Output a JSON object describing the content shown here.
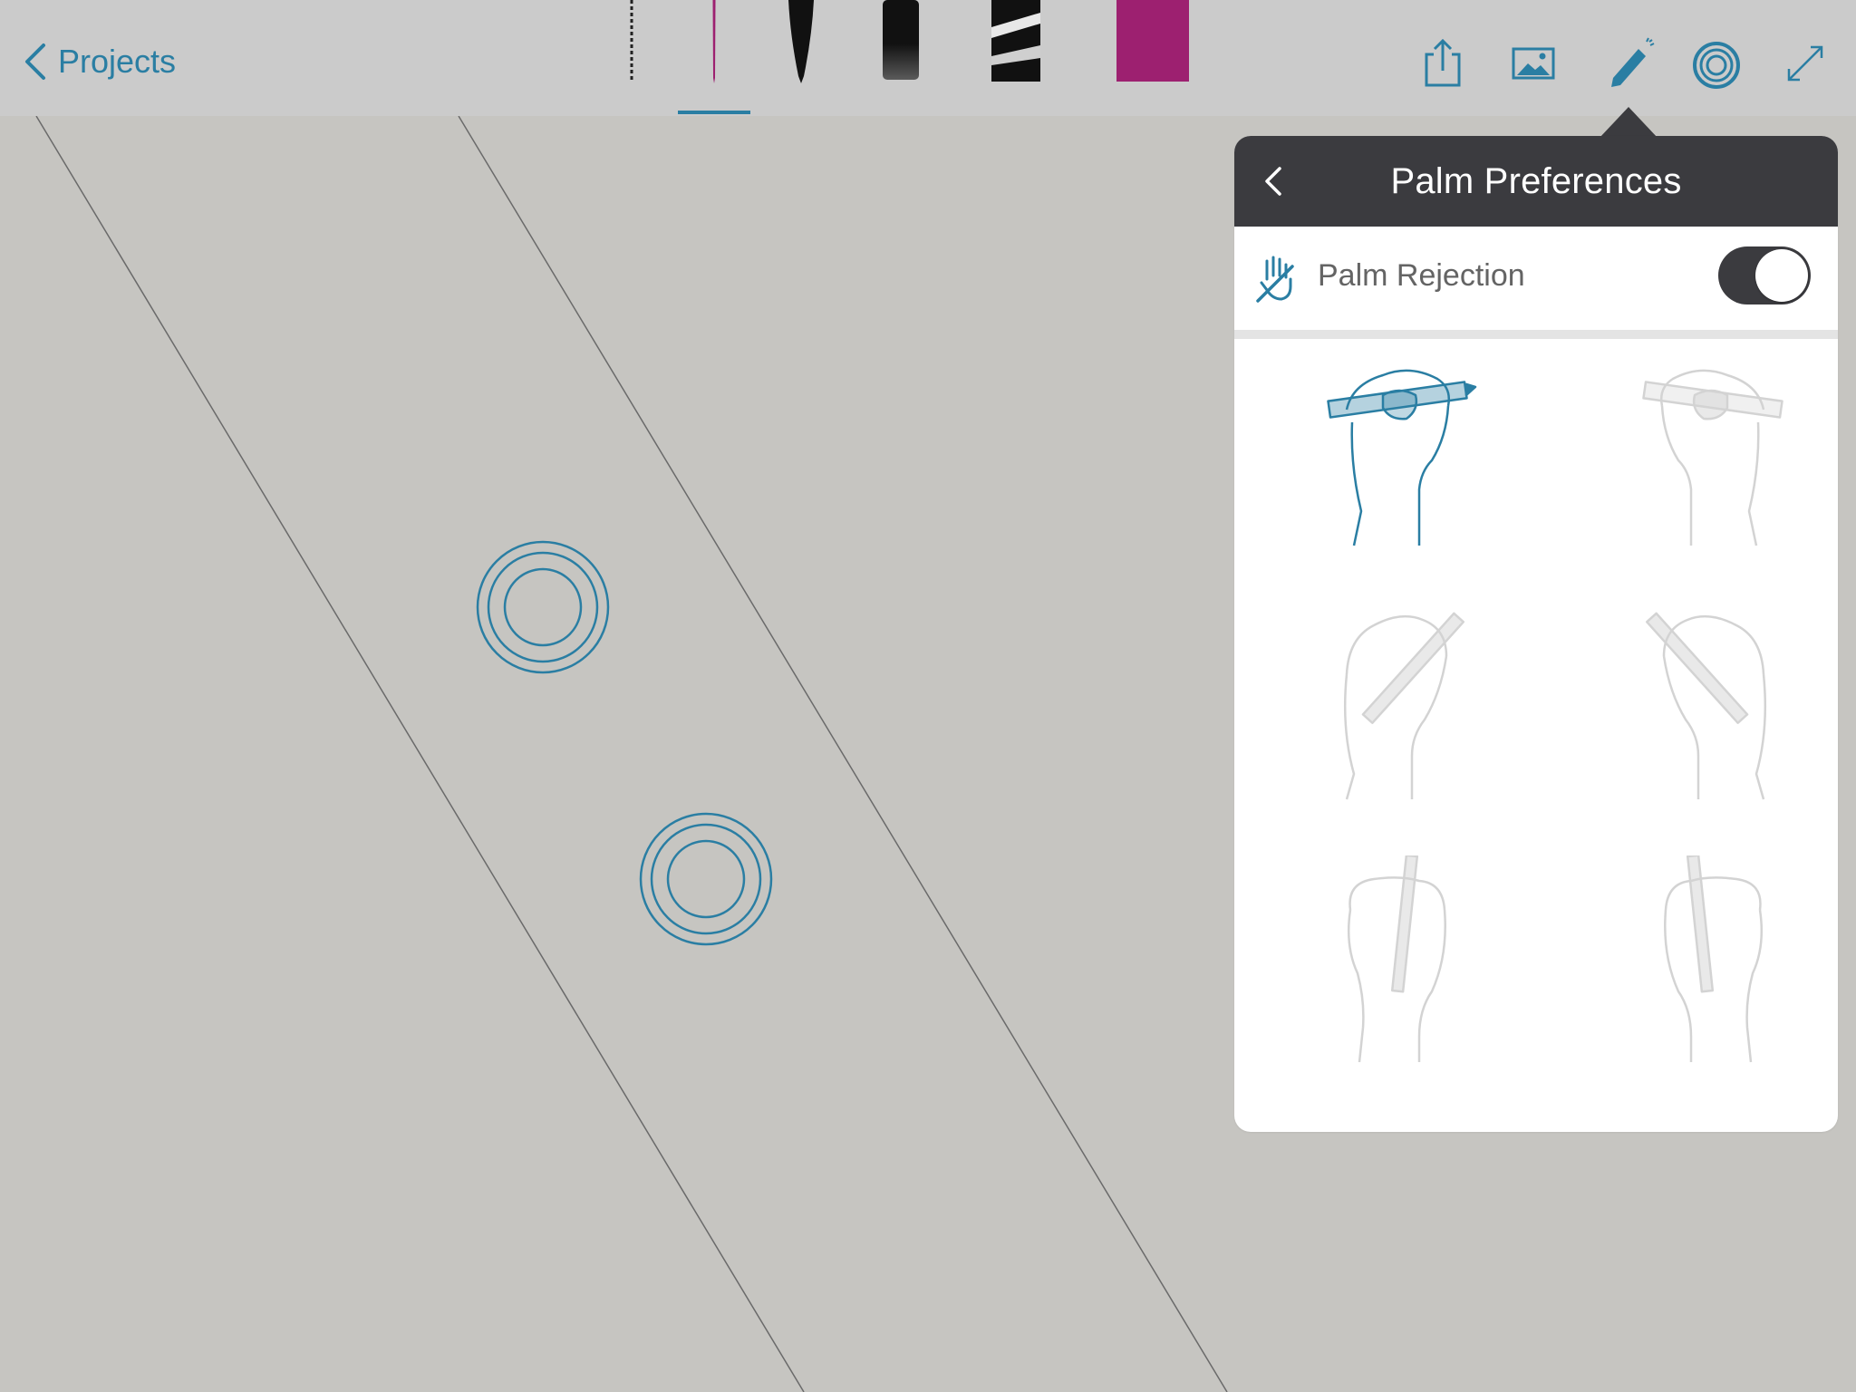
{
  "nav": {
    "back_label": "Projects"
  },
  "brushes": [
    {
      "name": "dashed-brush",
      "color": "#222222"
    },
    {
      "name": "thin-pen",
      "color": "#9d2070",
      "selected": true
    },
    {
      "name": "tapered-brush",
      "color": "#111111"
    },
    {
      "name": "marker",
      "color": "#111111"
    },
    {
      "name": "eraser",
      "color": "#111111"
    },
    {
      "name": "color-swatch",
      "color": "#9d2070"
    }
  ],
  "tools": [
    "share-icon",
    "image-icon",
    "pencil-icon",
    "stylus-icon",
    "fullscreen-icon"
  ],
  "popover": {
    "title": "Palm Preferences",
    "palm_rejection": {
      "label": "Palm Rejection",
      "enabled": true
    },
    "grips": [
      {
        "name": "overhand-right",
        "selected": true
      },
      {
        "name": "overhand-left",
        "selected": false
      },
      {
        "name": "angled-right",
        "selected": false
      },
      {
        "name": "angled-left",
        "selected": false
      },
      {
        "name": "vertical-right",
        "selected": false
      },
      {
        "name": "vertical-left",
        "selected": false
      }
    ]
  },
  "colors": {
    "accent": "#2a7ea3",
    "toolbar": "#cbcbcb",
    "canvas": "#c6c5c1",
    "popover_header": "#3b3b3f",
    "inactive_grip": "#d3d3d3"
  }
}
